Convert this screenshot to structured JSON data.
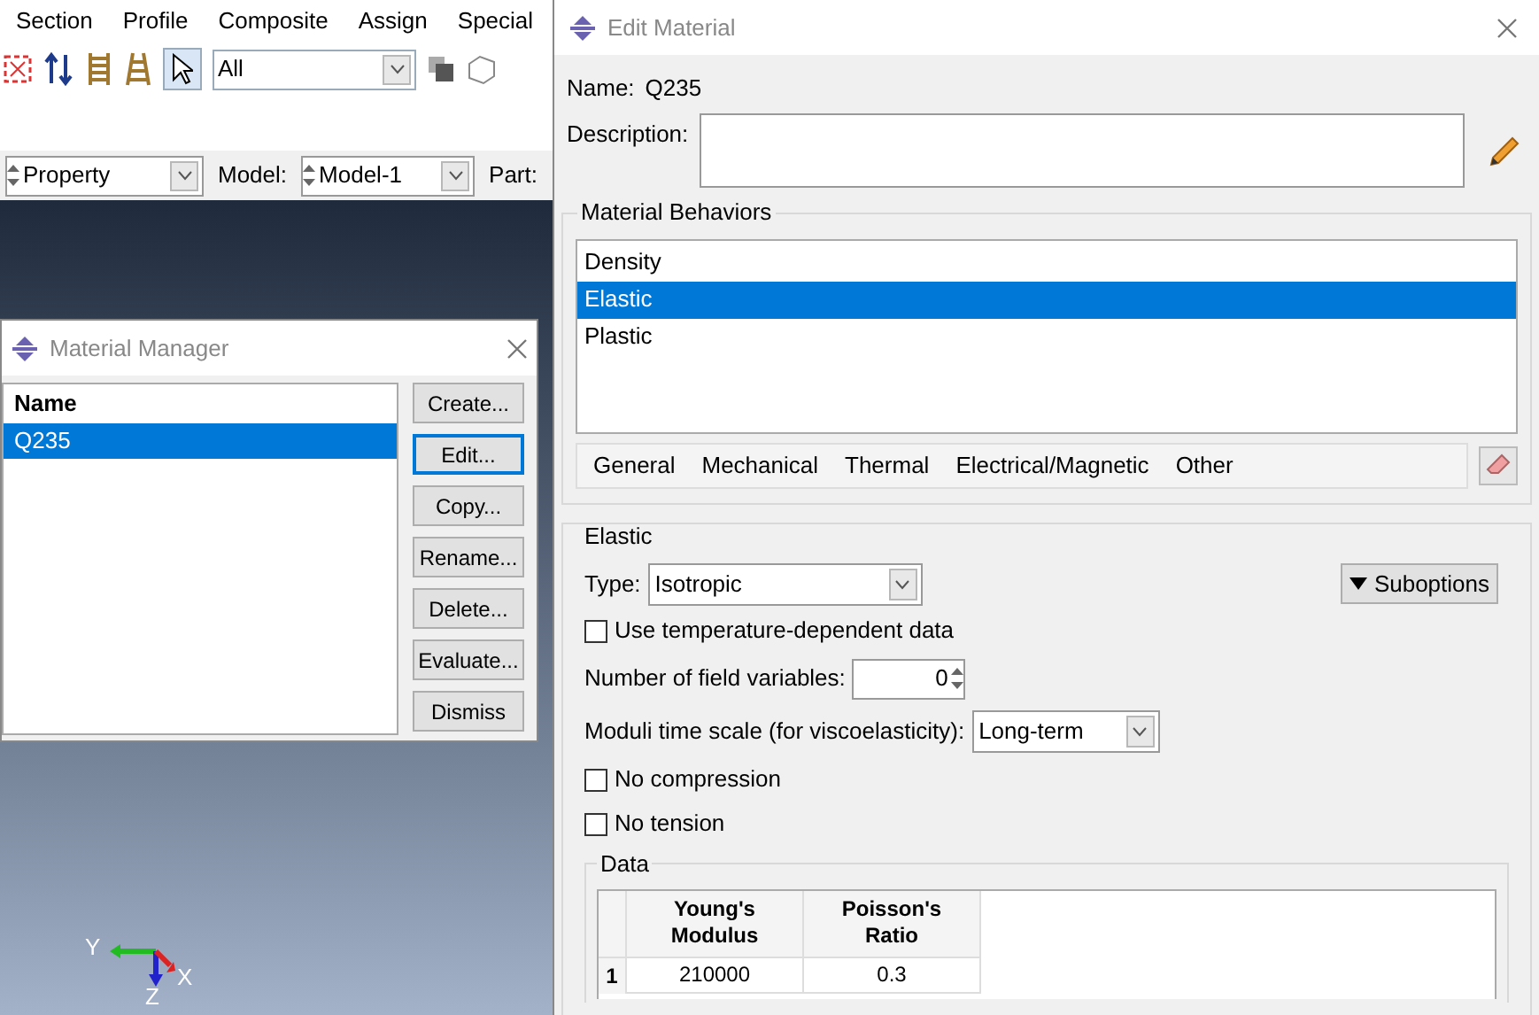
{
  "menu": [
    {
      "label": "Section"
    },
    {
      "label": "Profile"
    },
    {
      "label": "Composite"
    },
    {
      "label": "Assign"
    },
    {
      "label": "Special"
    }
  ],
  "toolbar": {
    "selection_filter": "All"
  },
  "context_bar": {
    "module_label": "Property",
    "model_label": "Model:",
    "model": "Model-1",
    "part_label": "Part:"
  },
  "viewport": {
    "axes": {
      "x": "X",
      "y": "Y",
      "z": "Z"
    }
  },
  "material_manager": {
    "title": "Material Manager",
    "column": "Name",
    "rows": [
      {
        "name": "Q235",
        "selected": true
      }
    ],
    "buttons": [
      {
        "label": "Create...",
        "focused": false
      },
      {
        "label": "Edit...",
        "focused": true
      },
      {
        "label": "Copy...",
        "focused": false
      },
      {
        "label": "Rename...",
        "focused": false
      },
      {
        "label": "Delete...",
        "focused": false
      },
      {
        "label": "Evaluate...",
        "focused": false
      },
      {
        "label": "Dismiss",
        "focused": false
      }
    ]
  },
  "edit_material": {
    "title": "Edit Material",
    "name_label": "Name:",
    "name": "Q235",
    "description_label": "Description:",
    "behaviors_title": "Material Behaviors",
    "behaviors": [
      {
        "label": "Density",
        "selected": false
      },
      {
        "label": "Elastic",
        "selected": true
      },
      {
        "label": "Plastic",
        "selected": false
      }
    ],
    "menus": [
      {
        "label": "General"
      },
      {
        "label": "Mechanical"
      },
      {
        "label": "Thermal"
      },
      {
        "label": "Electrical/Magnetic"
      },
      {
        "label": "Other"
      }
    ],
    "section_title": "Elastic",
    "type_label": "Type:",
    "type": "Isotropic",
    "suboptions": "Suboptions",
    "options": [
      {
        "kind": "checkbox",
        "label": "Use temperature-dependent data",
        "checked": false
      },
      {
        "kind": "spinner",
        "label": "Number of field variables:",
        "value": "0"
      },
      {
        "kind": "select",
        "label": "Moduli time scale (for viscoelasticity):",
        "value": "Long-term"
      },
      {
        "kind": "checkbox",
        "label": "No compression",
        "checked": false
      },
      {
        "kind": "checkbox",
        "label": "No tension",
        "checked": false
      }
    ],
    "data": {
      "title": "Data",
      "columns": [
        "Young's Modulus",
        "Poisson's Ratio"
      ],
      "rows": [
        {
          "index": "1",
          "cells": [
            "210000",
            "0.3"
          ]
        }
      ]
    }
  }
}
